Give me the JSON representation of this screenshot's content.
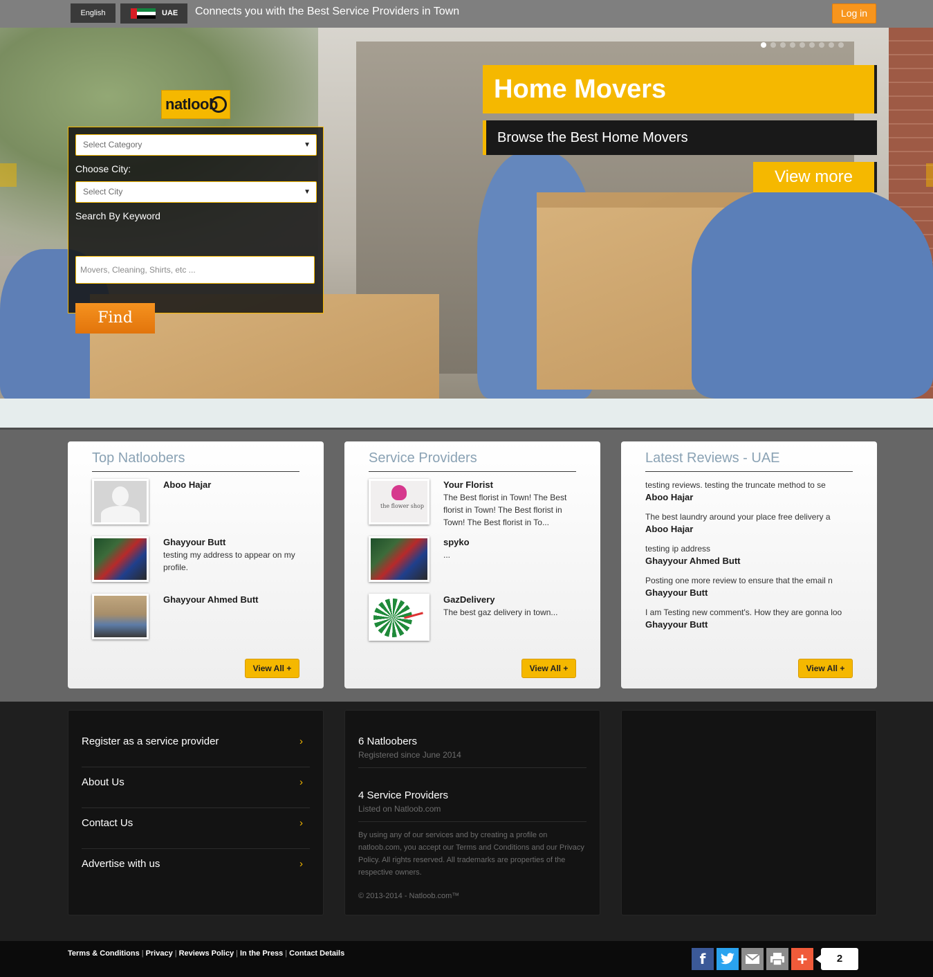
{
  "topbar": {
    "language": "English",
    "country": "UAE",
    "tagline": "Connects you with the Best Service Providers in Town",
    "login": "Log in"
  },
  "hero": {
    "title": "Home Movers",
    "subtitle": "Browse the Best Home Movers",
    "view_more": "View more",
    "slide_count": 9,
    "active_slide": 1
  },
  "logo": {
    "text": "natloob"
  },
  "search": {
    "category_placeholder": "Select Category",
    "city_label": "Choose City:",
    "city_placeholder": "Select City",
    "keyword_label": "Search By Keyword",
    "keyword_placeholder": "Movers, Cleaning, Shirts, etc ...",
    "find": "Find"
  },
  "top_natloobers": {
    "title": "Top Natloobers",
    "items": [
      {
        "name": "Aboo Hajar",
        "desc": ""
      },
      {
        "name": "Ghayyour Butt",
        "desc": "testing my address to appear on my profile."
      },
      {
        "name": "Ghayyour Ahmed Butt",
        "desc": ""
      }
    ],
    "view_all": "View All +"
  },
  "service_providers": {
    "title": "Service Providers",
    "items": [
      {
        "name": "Your Florist",
        "desc": "The Best florist in Town! The Best florist in Town! The Best florist in Town! The Best florist in To..."
      },
      {
        "name": "spyko",
        "desc": "..."
      },
      {
        "name": "GazDelivery",
        "desc": "The best gaz delivery in town..."
      }
    ],
    "view_all": "View All +"
  },
  "latest_reviews": {
    "title": "Latest Reviews - UAE",
    "items": [
      {
        "text": "testing reviews. testing the truncate method to se",
        "author": "Aboo Hajar"
      },
      {
        "text": "The best laundry around your place free delivery a",
        "author": "Aboo Hajar"
      },
      {
        "text": "testing ip address",
        "author": "Ghayyour Ahmed Butt"
      },
      {
        "text": "Posting one more review to ensure that the email n",
        "author": "Ghayyour Butt"
      },
      {
        "text": "I am Testing new comment's. How they are gonna loo",
        "author": "Ghayyour Butt"
      }
    ],
    "view_all": "View All +"
  },
  "footer": {
    "links": [
      "Register as a service provider",
      "About Us",
      "Contact Us",
      "Advertise with us"
    ],
    "stats": {
      "natloobers": "6 Natloobers",
      "natloobers_sub": "Registered since June 2014",
      "providers": "4 Service Providers",
      "providers_sub": "Listed on Natloob.com"
    },
    "legal": "By using any of our services and by creating a profile on natloob.com, you accept our Terms and Conditions and our Privacy Policy. All rights reserved. All trademarks are properties of the respective owners.",
    "copyright": "© 2013-2014 - Natloob.com™"
  },
  "bottom": {
    "links": [
      "Terms & Conditions",
      "Privacy",
      "Reviews Policy",
      "In the Press",
      "Contact Details"
    ],
    "share_count": "2"
  },
  "colors": {
    "accent": "#f5b800",
    "login": "#f7951d",
    "find": "#e2740b",
    "card_title": "#8aa2b4"
  },
  "icons": [
    "chevron-right-icon",
    "facebook-icon",
    "twitter-icon",
    "email-icon",
    "print-icon",
    "plus-icon"
  ]
}
